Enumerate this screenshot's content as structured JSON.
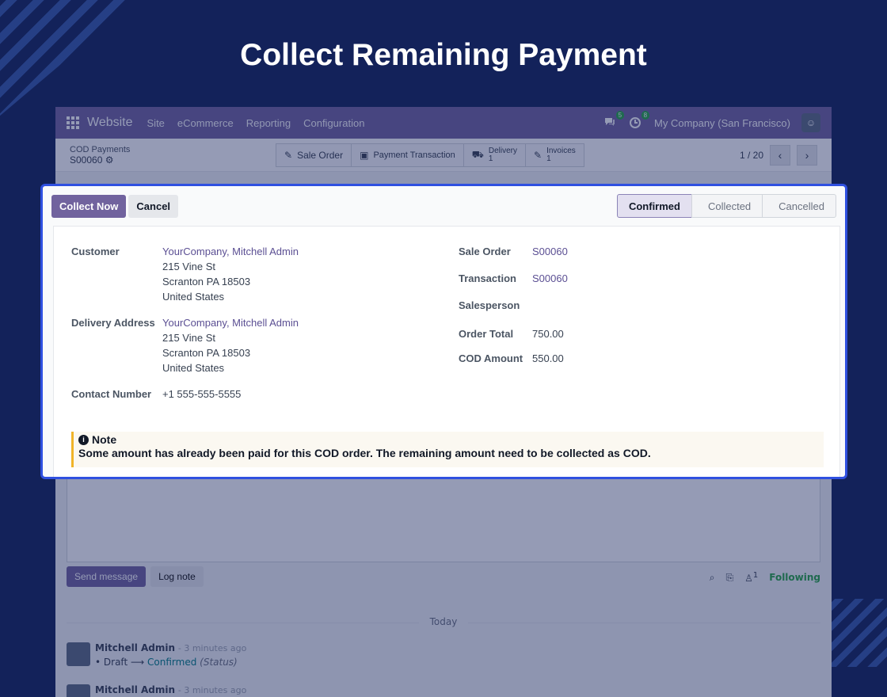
{
  "hero": {
    "title": "Collect Remaining Payment"
  },
  "navbar": {
    "brand": "Website",
    "menu": [
      "Site",
      "eCommerce",
      "Reporting",
      "Configuration"
    ],
    "messages_count": "5",
    "activities_count": "8",
    "company": "My Company (San Francisco)"
  },
  "control_panel": {
    "breadcrumb_parent": "COD Payments",
    "record": "S00060",
    "smart_buttons": {
      "sale_order": "Sale Order",
      "payment_transaction": "Payment Transaction",
      "delivery_label": "Delivery",
      "delivery_count": "1",
      "invoices_label": "Invoices",
      "invoices_count": "1"
    },
    "pager": "1 / 20"
  },
  "form": {
    "buttons": {
      "collect": "Collect Now",
      "cancel": "Cancel"
    },
    "stages": {
      "confirmed": "Confirmed",
      "collected": "Collected",
      "cancelled": "Cancelled"
    },
    "active_stage": "Confirmed",
    "customer": {
      "label": "Customer",
      "name": "YourCompany, Mitchell Admin",
      "street": "215 Vine St",
      "city": "Scranton PA 18503",
      "country": "United States"
    },
    "delivery": {
      "label": "Delivery Address",
      "name": "YourCompany, Mitchell Admin",
      "street": "215 Vine St",
      "city": "Scranton PA 18503",
      "country": "United States"
    },
    "contact": {
      "label": "Contact Number",
      "value": "+1 555-555-5555"
    },
    "sale_order": {
      "label": "Sale Order",
      "value": "S00060"
    },
    "transaction": {
      "label": "Transaction",
      "value": "S00060"
    },
    "salesperson": {
      "label": "Salesperson",
      "value": ""
    },
    "order_total": {
      "label": "Order Total",
      "value": "750.00"
    },
    "cod_amount": {
      "label": "COD Amount",
      "value": "550.00"
    },
    "note": {
      "title": "Note",
      "body": "Some amount has already been paid for this COD order. The remaining amount need to be collected as COD."
    }
  },
  "chatter": {
    "send_message": "Send message",
    "log_note": "Log note",
    "followers_count": "1",
    "following": "Following",
    "today": "Today",
    "messages": [
      {
        "author": "Mitchell Admin",
        "time": "- 3 minutes ago",
        "from": "Draft",
        "to": "Confirmed",
        "field": "(Status)"
      },
      {
        "author": "Mitchell Admin",
        "time": "- 3 minutes ago"
      }
    ]
  },
  "colors": {
    "accent": "#71639e",
    "highlight_border": "#2f50e0",
    "background": "#13225a",
    "following": "#28a745"
  }
}
